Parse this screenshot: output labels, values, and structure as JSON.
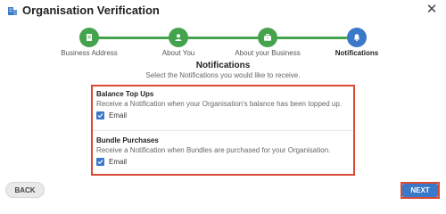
{
  "window": {
    "title": "Organisation Verification",
    "icon": "building-icon"
  },
  "stepper": {
    "steps": [
      {
        "label": "Business Address",
        "state": "done",
        "icon": "document-icon"
      },
      {
        "label": "About You",
        "state": "done",
        "icon": "person-icon"
      },
      {
        "label": "About your Business",
        "state": "done",
        "icon": "briefcase-icon"
      },
      {
        "label": "Notifications",
        "state": "active",
        "icon": "bell-icon"
      }
    ]
  },
  "section": {
    "title": "Notifications",
    "subtitle": "Select the Notifications you would like to receive."
  },
  "groups": [
    {
      "title": "Balance Top Ups",
      "description": "Receive a Notification when your Organisation's balance has been topped up.",
      "option_label": "Email",
      "checked": true
    },
    {
      "title": "Bundle Purchases",
      "description": "Receive a Notification when Bundles are purchased for your Organisation.",
      "option_label": "Email",
      "checked": true
    }
  ],
  "footer": {
    "back_label": "BACK",
    "next_label": "NEXT"
  },
  "colors": {
    "done": "#44a34c",
    "active": "#3a78c9",
    "highlight": "#d94a35"
  }
}
